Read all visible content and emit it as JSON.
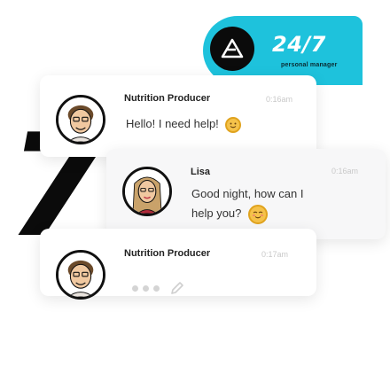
{
  "badge": {
    "main_text": "24/7",
    "sub_text": "personal manager",
    "logo_icon": "triangle-logo-icon",
    "color": "#1ec2dc"
  },
  "decor": {
    "big_number": "7"
  },
  "messages": [
    {
      "sender": "Nutrition Producer",
      "time": "0:16am",
      "text": "Hello! I need help!",
      "emoji": "smiling-face-emoji"
    },
    {
      "sender": "Lisa",
      "time": "0:16am",
      "text_line1": "Good night, how can I",
      "text_line2": "help you?",
      "emoji": "blushing-face-emoji"
    },
    {
      "sender": "Nutrition Producer",
      "time": "0:17am",
      "status": "typing",
      "status_icon": "pencil-icon"
    }
  ]
}
